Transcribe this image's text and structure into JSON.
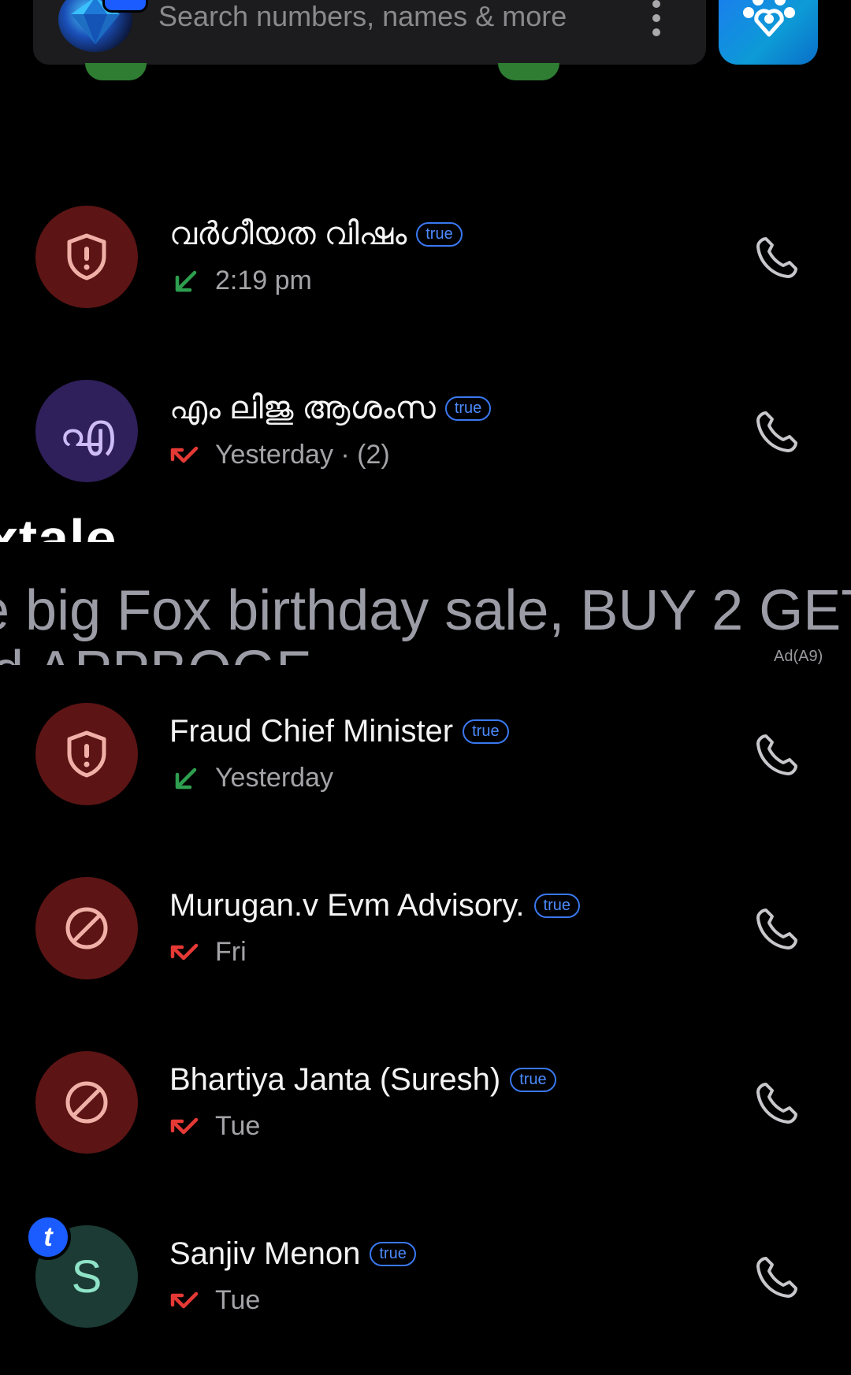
{
  "search": {
    "placeholder": "Search numbers, names & more"
  },
  "ad": {
    "title_fragment": "xtale",
    "body_line1": "e big Fox birthday sale, BUY 2 GET",
    "body_line2": "d APPBOGF",
    "label": "Ad(A9)"
  },
  "calls": [
    {
      "name": "വർഗീയത വിഷം",
      "badge": "true",
      "meta": "2:19 pm",
      "direction": "incoming",
      "avatar": "shield-icon",
      "avatar_color": "#5c1414"
    },
    {
      "name": "എം ലിജു ആശംസ",
      "badge": "true",
      "meta": "Yesterday · (2)",
      "direction": "missed",
      "avatar_letter": "എ",
      "avatar_color": "#2f1f5a"
    },
    {
      "name": "Fraud Chief Minister",
      "badge": "true",
      "meta": "Yesterday",
      "direction": "incoming",
      "avatar": "shield-icon",
      "avatar_color": "#5c1414"
    },
    {
      "name": "Murugan.v Evm Advisory.",
      "badge": "true",
      "meta": "Fri",
      "direction": "missed",
      "avatar": "block-icon",
      "avatar_color": "#5c1414"
    },
    {
      "name": "Bhartiya Janta (Suresh)",
      "badge": "true",
      "meta": "Tue",
      "direction": "missed",
      "avatar": "block-icon",
      "avatar_color": "#5c1414"
    },
    {
      "name": "Sanjiv Menon",
      "badge": "true",
      "meta": "Tue",
      "direction": "missed",
      "avatar_letter": "S",
      "avatar_color": "#1b3b34",
      "avatar_badge": "t"
    }
  ],
  "colors": {
    "incoming_arrow": "#2e9e4f",
    "missed_arrow": "#e53935",
    "true_badge": "#3a78f0",
    "call_icon": "#c8c8cc"
  }
}
